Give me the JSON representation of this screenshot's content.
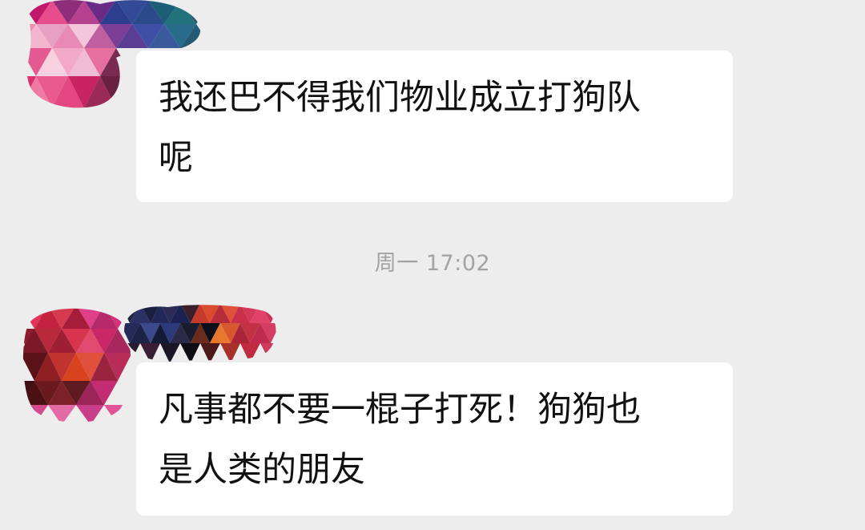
{
  "messages": [
    {
      "lines": [
        "我还巴不得我们物业成立打狗队",
        "呢"
      ]
    },
    {
      "lines": [
        "凡事都不要一棍子打死！狗狗也",
        "是人类的朋友"
      ]
    }
  ],
  "timestamp": "周一 17:02",
  "colors": {
    "background": "#ededed",
    "bubble": "#ffffff",
    "timestamp_text": "#a3a3a3"
  },
  "icons": {
    "avatar_1": "pixelated-avatar-icon",
    "avatar_2": "pixelated-avatar-icon",
    "nickname_2": "pixelated-nickname-mask"
  }
}
